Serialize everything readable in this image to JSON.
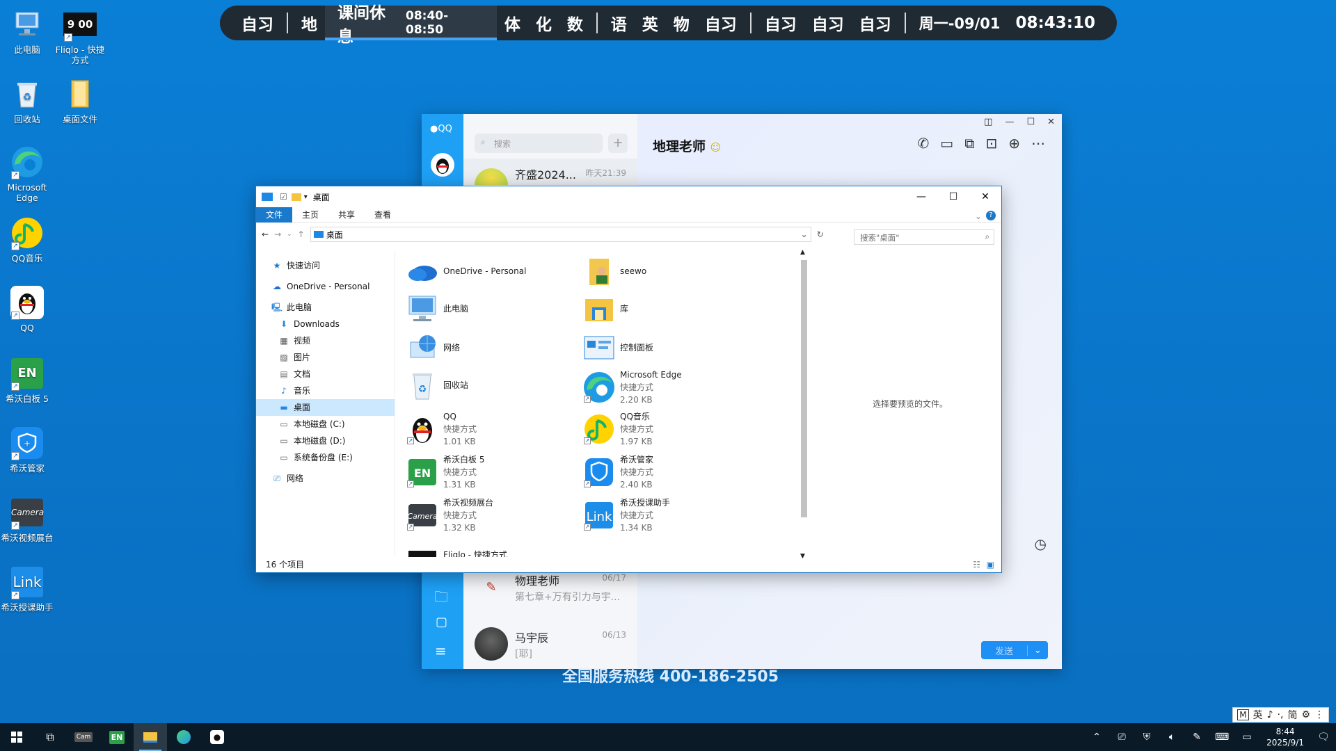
{
  "desktop": {
    "icons": [
      {
        "label": "此电脑"
      },
      {
        "label": "Fliqlo - 快捷方式",
        "clock_text": "9 00"
      },
      {
        "label": "回收站"
      },
      {
        "label": "桌面文件"
      },
      {
        "label": "Microsoft Edge"
      },
      {
        "label": "QQ音乐"
      },
      {
        "label": "QQ"
      },
      {
        "label": "希沃白板 5",
        "badge": "EN"
      },
      {
        "label": "希沃管家"
      },
      {
        "label": "希沃视频展台",
        "badge": "Camera"
      },
      {
        "label": "希沃授课助手",
        "badge": "Link"
      }
    ]
  },
  "schedule": {
    "cells_a": [
      "自习"
    ],
    "cells_b": [
      "地"
    ],
    "active_label": "课间休息",
    "active_time": "08:40-08:50",
    "cells_c": [
      "体",
      "化",
      "数"
    ],
    "cells_d": [
      "语",
      "英",
      "物",
      "自习"
    ],
    "cells_e": [
      "自习",
      "自习",
      "自习"
    ],
    "date": "周一-09/01",
    "time": "08:43:10"
  },
  "qq": {
    "brand": "QQ",
    "search_placeholder": "搜索",
    "plus": "+",
    "chat_title": "地理老师",
    "conversations": [
      {
        "name": "齐盛2024...",
        "time": "昨天21:39",
        "msg": ""
      },
      {
        "name": "物理老师",
        "time": "06/17",
        "msg": "第七章+万有引力与宇..."
      },
      {
        "name": "马宇辰",
        "time": "06/13",
        "msg": "[耶]"
      }
    ],
    "send_label": "发送",
    "hotline": "全国服务热线 400-186-2505"
  },
  "explorer": {
    "title": "桌面",
    "ribbon_tabs": [
      "文件",
      "主页",
      "共享",
      "查看"
    ],
    "address": "桌面",
    "search_placeholder": "搜索\"桌面\"",
    "nav": [
      {
        "label": "快速访问",
        "icon": "star-icon"
      },
      {
        "label": "OneDrive - Personal",
        "icon": "cloud-icon"
      },
      {
        "label": "此电脑",
        "icon": "pc-icon"
      },
      {
        "label": "Downloads",
        "icon": "download-icon"
      },
      {
        "label": "视频",
        "icon": "video-icon"
      },
      {
        "label": "图片",
        "icon": "picture-icon"
      },
      {
        "label": "文档",
        "icon": "document-icon"
      },
      {
        "label": "音乐",
        "icon": "music-icon"
      },
      {
        "label": "桌面",
        "icon": "desktop-icon"
      },
      {
        "label": "本地磁盘 (C:)",
        "icon": "drive-icon"
      },
      {
        "label": "本地磁盘 (D:)",
        "icon": "drive-icon"
      },
      {
        "label": "系统备份盘 (E:)",
        "icon": "drive-icon"
      },
      {
        "label": "网络",
        "icon": "network-icon"
      }
    ],
    "items": [
      {
        "name": "OneDrive - Personal",
        "type": "",
        "size": ""
      },
      {
        "name": "seewo",
        "type": "",
        "size": ""
      },
      {
        "name": "此电脑",
        "type": "",
        "size": ""
      },
      {
        "name": "库",
        "type": "",
        "size": ""
      },
      {
        "name": "网络",
        "type": "",
        "size": ""
      },
      {
        "name": "控制面板",
        "type": "",
        "size": ""
      },
      {
        "name": "回收站",
        "type": "",
        "size": ""
      },
      {
        "name": "Microsoft Edge",
        "type": "快捷方式",
        "size": "2.20 KB"
      },
      {
        "name": "QQ",
        "type": "快捷方式",
        "size": "1.01 KB"
      },
      {
        "name": "QQ音乐",
        "type": "快捷方式",
        "size": "1.97 KB"
      },
      {
        "name": "希沃白板 5",
        "type": "快捷方式",
        "size": "1.31 KB"
      },
      {
        "name": "希沃管家",
        "type": "快捷方式",
        "size": "2.40 KB"
      },
      {
        "name": "希沃视频展台",
        "type": "快捷方式",
        "size": "1.32 KB"
      },
      {
        "name": "希沃授课助手",
        "type": "快捷方式",
        "size": "1.34 KB"
      },
      {
        "name": "Fliqlo - 快捷方式",
        "type": "",
        "size": ""
      }
    ],
    "preview_text": "选择要预览的文件。",
    "status": "16 个项目"
  },
  "ime": {
    "items": [
      "M",
      "英",
      "♪",
      "·,",
      "简",
      "⚙",
      "⋮"
    ]
  },
  "taskbar": {
    "time": "8:44",
    "date": "2025/9/1",
    "camera_label": "Cam"
  },
  "colors": {
    "desktop": "#0a7fd6",
    "accent": "#1979ca",
    "qq_blue": "#1ea0f5",
    "schedule_bg": "#1f2a33"
  }
}
